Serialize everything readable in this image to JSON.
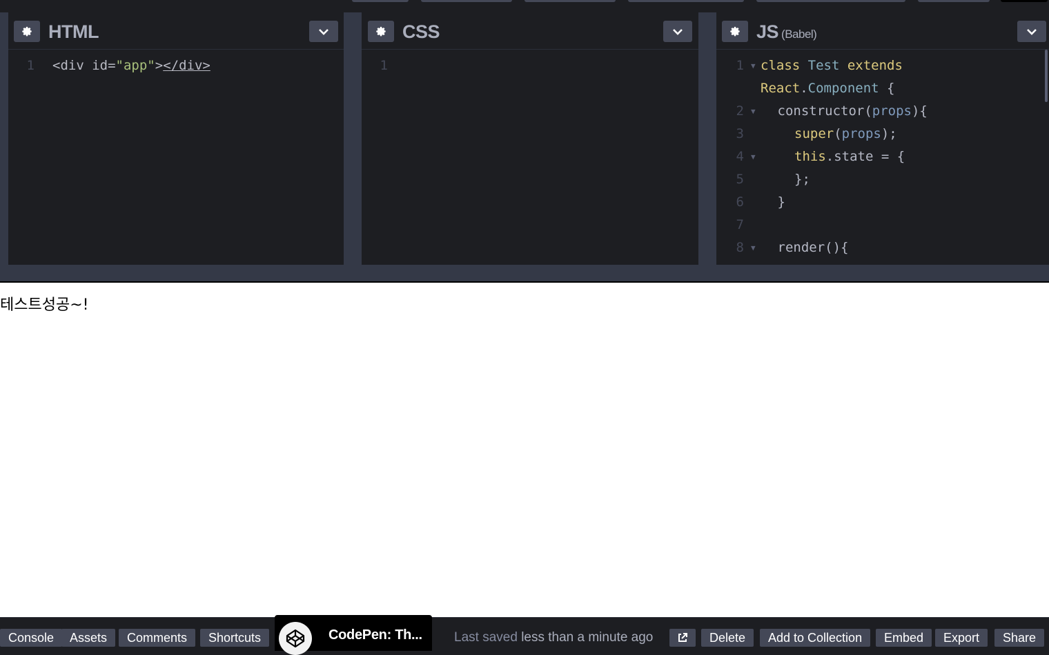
{
  "html_pane": {
    "title": "HTML",
    "lines": [
      {
        "num": "1",
        "parts": [
          {
            "cls": "t-tag",
            "text": "<div "
          },
          {
            "cls": "t-attr",
            "text": "id="
          },
          {
            "cls": "t-str",
            "text": "\"app\""
          },
          {
            "cls": "t-tag",
            "text": ">"
          },
          {
            "cls": "t-tag u",
            "text": "</div>"
          }
        ]
      }
    ]
  },
  "css_pane": {
    "title": "CSS",
    "lines": [
      {
        "num": "1",
        "parts": []
      }
    ]
  },
  "js_pane": {
    "title": "JS",
    "subtitle": "(Babel)",
    "lines": [
      {
        "num": "1",
        "fold": true,
        "indent": 0,
        "parts": [
          {
            "cls": "t-kw",
            "text": "class "
          },
          {
            "cls": "t-cls",
            "text": "Test "
          },
          {
            "cls": "t-kw",
            "text": "extends"
          }
        ]
      },
      {
        "num": "",
        "fold": false,
        "indent": 0,
        "parts": [
          {
            "cls": "t-kw",
            "text": "React"
          },
          {
            "cls": "t-def",
            "text": "."
          },
          {
            "cls": "t-cls",
            "text": "Component"
          },
          {
            "cls": "t-def",
            "text": " {"
          }
        ]
      },
      {
        "num": "2",
        "fold": true,
        "indent": 1,
        "parts": [
          {
            "cls": "t-def",
            "text": "constructor("
          },
          {
            "cls": "t-prop",
            "text": "props"
          },
          {
            "cls": "t-def",
            "text": "){"
          }
        ]
      },
      {
        "num": "3",
        "fold": false,
        "indent": 2,
        "parts": [
          {
            "cls": "t-kw",
            "text": "super"
          },
          {
            "cls": "t-def",
            "text": "("
          },
          {
            "cls": "t-prop",
            "text": "props"
          },
          {
            "cls": "t-def",
            "text": ");"
          }
        ]
      },
      {
        "num": "4",
        "fold": true,
        "indent": 2,
        "parts": [
          {
            "cls": "t-this",
            "text": "this"
          },
          {
            "cls": "t-def",
            "text": ".state = {"
          }
        ]
      },
      {
        "num": "5",
        "fold": false,
        "indent": 2,
        "parts": [
          {
            "cls": "t-def",
            "text": "};"
          }
        ]
      },
      {
        "num": "6",
        "fold": false,
        "indent": 1,
        "parts": [
          {
            "cls": "t-def",
            "text": "}"
          }
        ]
      },
      {
        "num": "7",
        "fold": false,
        "indent": 0,
        "parts": []
      },
      {
        "num": "8",
        "fold": true,
        "indent": 1,
        "parts": [
          {
            "cls": "t-def",
            "text": "render(){"
          }
        ]
      }
    ]
  },
  "preview": {
    "output_text": "테스트성공~!"
  },
  "footer": {
    "console": "Console",
    "assets": "Assets",
    "comments": "Comments",
    "shortcuts": "Shortcuts",
    "pen_title": "CodePen: Th...",
    "saved_prefix": "Last saved",
    "saved_time": "less than a minute ago",
    "delete": "Delete",
    "add_to_collection": "Add to Collection",
    "embed": "Embed",
    "export": "Export",
    "share": "Share"
  },
  "icons": {
    "settings": "gear-icon",
    "collapse": "chevron-down-icon",
    "popout": "external-link-icon",
    "logo": "codepen-logo"
  },
  "colors": {
    "editor_bg": "#1d1e22",
    "button_bg": "#444857",
    "keyword": "#ddca7e",
    "string": "#a8c07b",
    "class": "#88afbf"
  }
}
